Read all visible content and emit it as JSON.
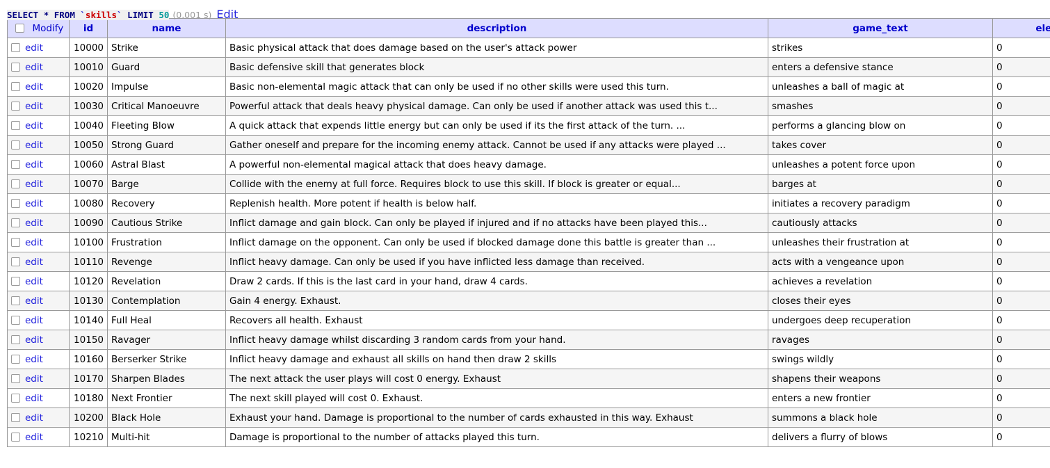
{
  "query": {
    "keyword_select": "SELECT",
    "star": "*",
    "keyword_from": "FROM",
    "backtick_open": "`",
    "table_name": "skills",
    "backtick_close": "`",
    "keyword_limit": "LIMIT",
    "limit_value": "50",
    "exec_time": "(0.001 s)",
    "edit_label": "Edit",
    "colors": {
      "keyword": "#000080",
      "identifier": "#cc0000",
      "number": "#009999",
      "time": "#999999",
      "link": "#2222dd"
    }
  },
  "table": {
    "header_bg": "#ddddff",
    "header_fg": "#0000cc",
    "row_alt_bg": "#f5f5f5",
    "border_color": "#999999",
    "columns": [
      {
        "key": "modify",
        "label": "Modify"
      },
      {
        "key": "id",
        "label": "id"
      },
      {
        "key": "name",
        "label": "name"
      },
      {
        "key": "description",
        "label": "description"
      },
      {
        "key": "game_text",
        "label": "game_text"
      },
      {
        "key": "element",
        "label": "element"
      }
    ],
    "row_action_label": "edit",
    "rows": [
      {
        "id": "10000",
        "name": "Strike",
        "description": "Basic physical attack that does damage based on the user's attack power",
        "game_text": "strikes",
        "element": "0"
      },
      {
        "id": "10010",
        "name": "Guard",
        "description": "Basic defensive skill that generates block",
        "game_text": "enters a defensive stance",
        "element": "0"
      },
      {
        "id": "10020",
        "name": "Impulse",
        "description": "Basic non-elemental magic attack that can only be used if no other skills were used this turn.",
        "game_text": "unleashes a ball of magic at",
        "element": "0"
      },
      {
        "id": "10030",
        "name": "Critical Manoeuvre",
        "description": "Powerful attack that deals heavy physical damage. Can only be used if another attack was used this t...",
        "game_text": "smashes",
        "element": "0"
      },
      {
        "id": "10040",
        "name": "Fleeting Blow",
        "description": "A quick attack that expends little energy but can only be used if its the first attack of the turn. ...",
        "game_text": "performs a glancing blow on",
        "element": "0"
      },
      {
        "id": "10050",
        "name": "Strong Guard",
        "description": "Gather oneself and prepare for the incoming enemy attack. Cannot be used if any attacks were played ...",
        "game_text": "takes cover",
        "element": "0"
      },
      {
        "id": "10060",
        "name": "Astral Blast",
        "description": "A powerful non-elemental magical attack that does heavy damage.",
        "game_text": "unleashes a potent force upon",
        "element": "0"
      },
      {
        "id": "10070",
        "name": "Barge",
        "description": "Collide with the enemy at full force. Requires block to use this skill. If block is greater or equal...",
        "game_text": "barges at",
        "element": "0"
      },
      {
        "id": "10080",
        "name": "Recovery",
        "description": "Replenish health. More potent if health is below half.",
        "game_text": "initiates a recovery paradigm",
        "element": "0"
      },
      {
        "id": "10090",
        "name": "Cautious Strike",
        "description": "Inflict damage and gain block. Can only be played if injured and if no attacks have been played this...",
        "game_text": "cautiously attacks",
        "element": "0"
      },
      {
        "id": "10100",
        "name": "Frustration",
        "description": "Inflict damage on the opponent. Can only be used if blocked damage done this battle is greater than ...",
        "game_text": "unleashes their frustration at",
        "element": "0"
      },
      {
        "id": "10110",
        "name": "Revenge",
        "description": "Inflict heavy damage. Can only be used if you have inflicted less damage than received.",
        "game_text": "acts with a vengeance upon",
        "element": "0"
      },
      {
        "id": "10120",
        "name": "Revelation",
        "description": "Draw 2 cards. If this is the last card in your hand, draw 4 cards.",
        "game_text": "achieves a revelation",
        "element": "0"
      },
      {
        "id": "10130",
        "name": "Contemplation",
        "description": "Gain 4 energy. Exhaust.",
        "game_text": "closes their eyes",
        "element": "0"
      },
      {
        "id": "10140",
        "name": "Full Heal",
        "description": "Recovers all health. Exhaust",
        "game_text": "undergoes deep recuperation",
        "element": "0"
      },
      {
        "id": "10150",
        "name": "Ravager",
        "description": "Inflict heavy damage whilst discarding 3 random cards from your hand.",
        "game_text": "ravages",
        "element": "0"
      },
      {
        "id": "10160",
        "name": "Berserker Strike",
        "description": "Inflict heavy damage and exhaust all skills on hand then draw 2 skills",
        "game_text": "swings wildly",
        "element": "0"
      },
      {
        "id": "10170",
        "name": "Sharpen Blades",
        "description": "The next attack the user plays will cost 0 energy. Exhaust",
        "game_text": "shapens their weapons",
        "element": "0"
      },
      {
        "id": "10180",
        "name": "Next Frontier",
        "description": "The next skill played will cost 0. Exhaust.",
        "game_text": "enters a new frontier",
        "element": "0"
      },
      {
        "id": "10200",
        "name": "Black Hole",
        "description": "Exhaust your hand. Damage is proportional to the number of cards exhausted in this way. Exhaust",
        "game_text": "summons a black hole",
        "element": "0"
      },
      {
        "id": "10210",
        "name": "Multi-hit",
        "description": "Damage is proportional to the number of attacks played this turn.",
        "game_text": "delivers a flurry of blows",
        "element": "0"
      }
    ]
  }
}
